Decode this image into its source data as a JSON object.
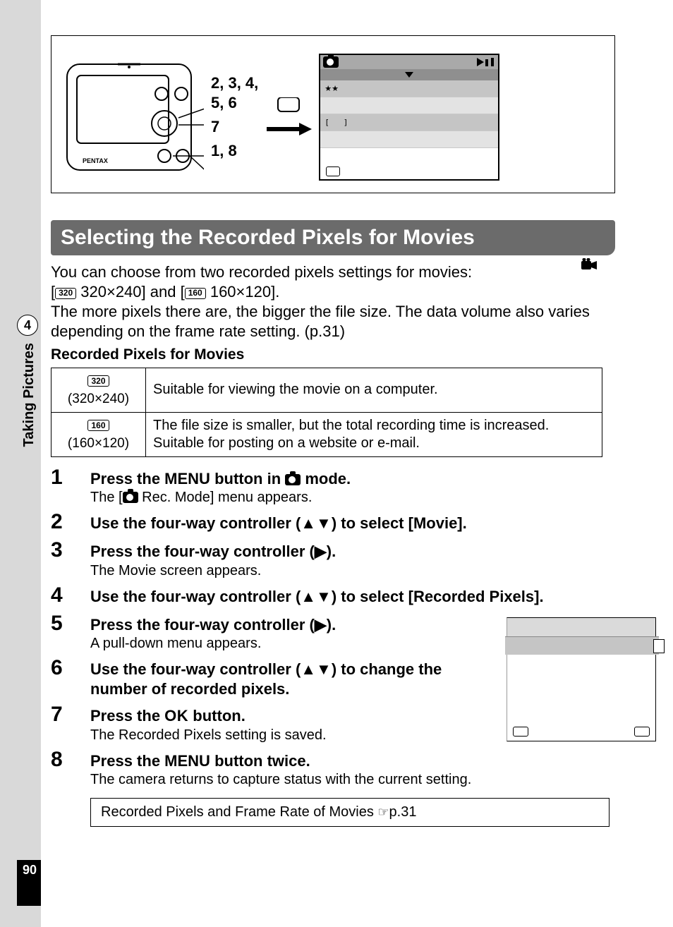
{
  "page_number": "90",
  "chapter_number": "4",
  "side_label": "Taking Pictures",
  "diagram": {
    "btn_labels_1": "2, 3, 4,",
    "btn_labels_2": "5, 6",
    "btn_labels_3": "7",
    "btn_labels_4": "1, 8",
    "camera_brand": "PENTAX"
  },
  "section_title": "Selecting the Recorded Pixels for Movies",
  "intro": {
    "line1": "You can choose from two recorded pixels settings for movies:",
    "opt1_badge": "320",
    "opt1_text": " 320×240] and [",
    "opt2_badge": "160",
    "opt2_text": " 160×120].",
    "line3": "The more pixels there are, the bigger the file size. The data volume also varies depending on the frame rate setting. (p.31)"
  },
  "table_heading": "Recorded Pixels for Movies",
  "table": {
    "row1_badge": "320",
    "row1_dim": "(320×240)",
    "row1_desc": "Suitable for viewing the movie on a computer.",
    "row2_badge": "160",
    "row2_dim": "(160×120)",
    "row2_desc": "The file size is smaller, but the total recording time is increased. Suitable for posting on a website or e-mail."
  },
  "steps": {
    "s1_h_a": "Press the ",
    "s1_h_menu": "MENU",
    "s1_h_b": " button in ",
    "s1_h_c": " mode.",
    "s1_sub_a": "The [",
    "s1_sub_b": " Rec. Mode] menu appears.",
    "s2_h": "Use the four-way controller (▲▼) to select [Movie].",
    "s3_h": "Press the four-way controller (▶).",
    "s3_sub": "The Movie screen appears.",
    "s4_h": "Use the four-way controller (▲▼) to select [Recorded Pixels].",
    "s5_h": "Press the four-way controller (▶).",
    "s5_sub": "A pull-down menu appears.",
    "s6_h": "Use the four-way controller (▲▼) to change the number of recorded pixels.",
    "s7_h_a": "Press the ",
    "s7_h_ok": "OK",
    "s7_h_b": " button.",
    "s7_sub": "The Recorded Pixels setting is saved.",
    "s8_h_a": "Press the ",
    "s8_h_menu": "MENU",
    "s8_h_b": " button twice.",
    "s8_sub": "The camera returns to capture status with the current setting."
  },
  "ref_box": {
    "text": "Recorded Pixels and Frame Rate of Movies ",
    "pointer": "☞",
    "page": "p.31"
  },
  "step_nums": {
    "n1": "1",
    "n2": "2",
    "n3": "3",
    "n4": "4",
    "n5": "5",
    "n6": "6",
    "n7": "7",
    "n8": "8"
  }
}
